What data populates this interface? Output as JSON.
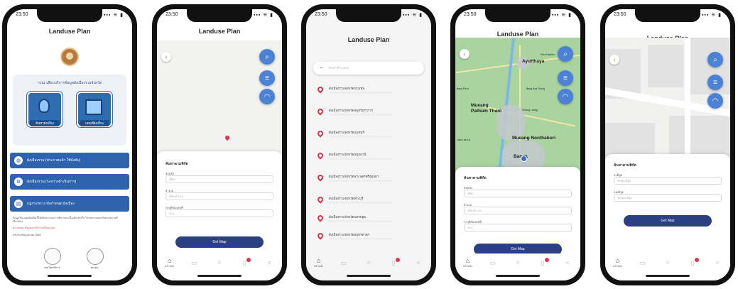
{
  "status": {
    "time": "23:50",
    "signal": "▪▪▪ ≋ ▮"
  },
  "app_title": "Landuse Plan",
  "home": {
    "heading": "กรุณาเลือกบริการข้อมูลผังเมืองรวมจังหวัด",
    "tiles": [
      {
        "label": "ค้นหาผังเมือง",
        "icon": "location-pin-icon"
      },
      {
        "label": "แผนที่ผังเมือง",
        "icon": "folded-map-icon"
      }
    ],
    "menu": [
      {
        "label": "ผังเมืองรวม (ประกาศแล้ว ใช้บังคับ)",
        "icon": "globe-icon"
      },
      {
        "label": "ผังเมืองรวม (ระหว่างดำเนินการ)",
        "icon": "gear-icon"
      },
      {
        "label": "กฎกระทรวง ข้อกำหนด ผังเมือง",
        "icon": "book-icon"
      }
    ],
    "disclaimer": "ข้อมูลในแอปพลิเคชันนี้ใช้เพื่อประกอบการพิจารณาเบื้องต้นเท่านั้น โปรดตรวจสอบกับหน่วยงานที่เกี่ยวข้อง",
    "warning": "หมายเหตุ: ข้อมูลอาจมีการเปลี่ยนแปลง",
    "update": "ปรับปรุงข้อมูลล่าสุด 2565",
    "emblems": [
      {
        "label": "กรมโยธาธิการ"
      },
      {
        "label": "สมาคม"
      }
    ]
  },
  "form": {
    "title": "ค้นหาตามพิกัด",
    "fields": [
      {
        "label": "จังหวัด",
        "placeholder": "เลือก"
      },
      {
        "label": "อำเภอ",
        "placeholder": "เลือกอำเภอ"
      },
      {
        "label": "ระบุพิกัด/เลขที่",
        "placeholder": "ระบุ"
      }
    ],
    "button": "Get Map"
  },
  "list": {
    "search_placeholder": "ค้นหาตำแหน่ง",
    "items": [
      "ผังเมืองรวมจังหวัดกรุงเทพ",
      "ผังเมืองรวมจังหวัดสมุทรปราการ",
      "ผังเมืองรวมจังหวัดนนทบุรี",
      "ผังเมืองรวมจังหวัดปทุมธานี",
      "ผังเมืองรวมจังหวัดพระนครศรีอยุธยา",
      "ผังเมืองรวมจังหวัดสระบุรี",
      "ผังเมืองรวมจังหวัดนครปฐม",
      "ผังเมืองรวมจังหวัดสมุทรสาคร"
    ]
  },
  "map": {
    "places": {
      "ayutthaya": "Ayutthaya",
      "pathum": "Mueang\nPathum Thani",
      "nonthaburi": "Mueang Nonthaburi",
      "bangkok": "Bangk",
      "khlong": "Khlong Luang",
      "nakhon": "Lam Luk Ka",
      "bangbua": "Bang Bua Thong",
      "phayathai": "Bang Pa-in",
      "krathum": "Phra Nakhon"
    }
  },
  "street_form": {
    "title": "ค้นหาตามพิกัด",
    "fields": [
      {
        "label": "ละติจูด",
        "placeholder": "ระบุละติจูด"
      },
      {
        "label": "ลองจิจูด",
        "placeholder": "ระบุลองจิจูด"
      }
    ],
    "button": "Get Map"
  },
  "tabbar": {
    "home_label": "หน้าหลัก"
  },
  "colors": {
    "primary": "#2d64ad",
    "button": "#2b3f83",
    "fab": "#4b82d6",
    "marker": "#e2324a"
  }
}
